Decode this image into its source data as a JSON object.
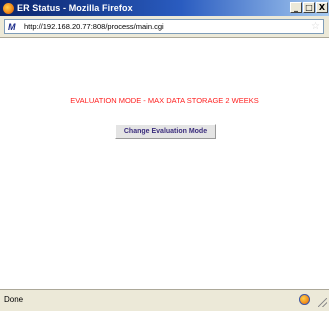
{
  "window": {
    "title": "ER Status - Mozilla Firefox",
    "controls": {
      "minimize": "_",
      "maximize": "□",
      "close": "X"
    }
  },
  "addressbar": {
    "site_icon": "M",
    "url": "http://192.168.20.77:808/process/main.cgi",
    "bookmark_icon": "☆"
  },
  "content": {
    "mode_text": "EVALUATION MODE - MAX DATA STORAGE 2 WEEKS",
    "mode_button_label": "Change Evaluation Mode"
  },
  "statusbar": {
    "text": "Done"
  },
  "colors": {
    "mode_text": "#ff2020",
    "button_text": "#3b2d7d",
    "titlebar": "#0a246a"
  },
  "icons": {
    "title": "firefox-icon",
    "site": "site-favicon-icon",
    "bookmark": "bookmark-star-icon",
    "status": "firefox-status-icon",
    "grip": "resize-grip-icon"
  }
}
